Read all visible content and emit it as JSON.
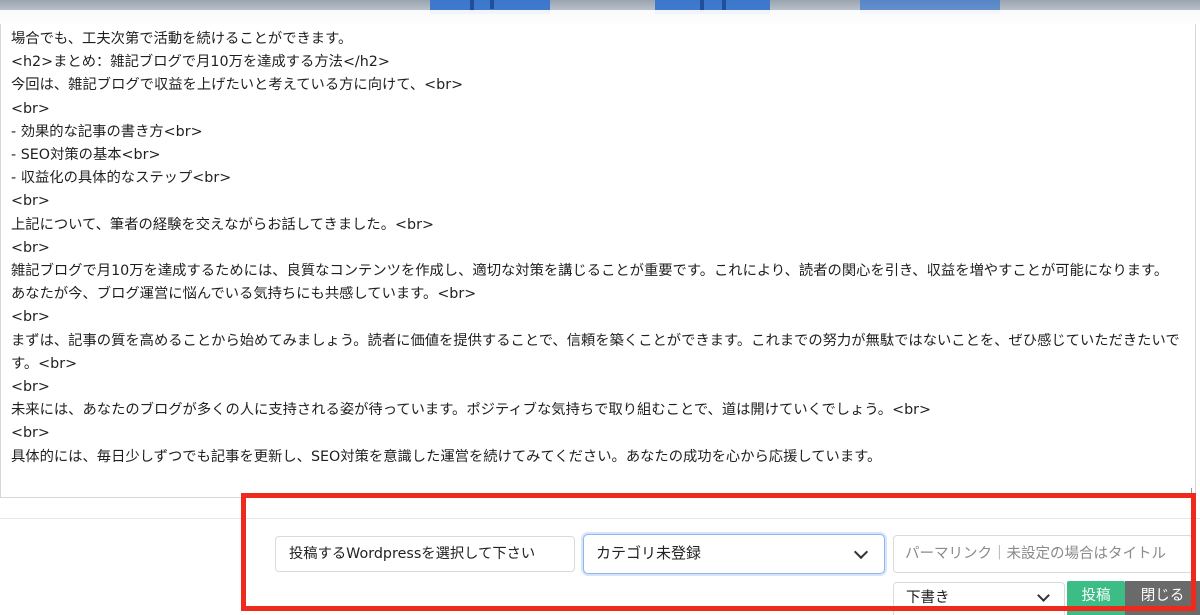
{
  "editor": {
    "lines": [
      "場合でも、工夫次第で活動を続けることができます。",
      "<h2>まとめ：雑記ブログで月10万を達成する方法</h2>",
      "今回は、雑記ブログで収益を上げたいと考えている方に向けて、<br>",
      "<br>",
      "- 効果的な記事の書き方<br>",
      "- SEO対策の基本<br>",
      "- 収益化の具体的なステップ<br>",
      "<br>",
      "上記について、筆者の経験を交えながらお話してきました。<br>",
      "<br>",
      "雑記ブログで月10万を達成するためには、良質なコンテンツを作成し、適切な対策を講じることが重要です。これにより、読者の関心を引き、収益を増やすことが可能になります。あなたが今、ブログ運営に悩んでいる気持ちにも共感しています。<br>",
      "<br>",
      "まずは、記事の質を高めることから始めてみましょう。読者に価値を提供することで、信頼を築くことができます。これまでの努力が無駄ではないことを、ぜひ感じていただきたいです。<br>",
      "<br>",
      "未来には、あなたのブログが多くの人に支持される姿が待っています。ポジティブな気持ちで取り組むことで、道は開けていくでしょう。<br>",
      "<br>",
      "具体的には、毎日少しずつでも記事を更新し、SEO対策を意識した運営を続けてみてください。あなたの成功を心から応援しています。"
    ]
  },
  "controls": {
    "wp_select_label": "投稿するWordpressを選択して下さい",
    "category_value": "カテゴリ未登録",
    "permalink_placeholder": "パーマリンク｜未設定の場合はタイトル",
    "status_value": "下書き",
    "post_label": "投稿",
    "close_label": "閉じる"
  },
  "colors": {
    "highlight": "#ee2a1c",
    "post_button": "#3dbd86",
    "close_button": "#6a6a6a",
    "focus_border": "#8fb6ee"
  }
}
